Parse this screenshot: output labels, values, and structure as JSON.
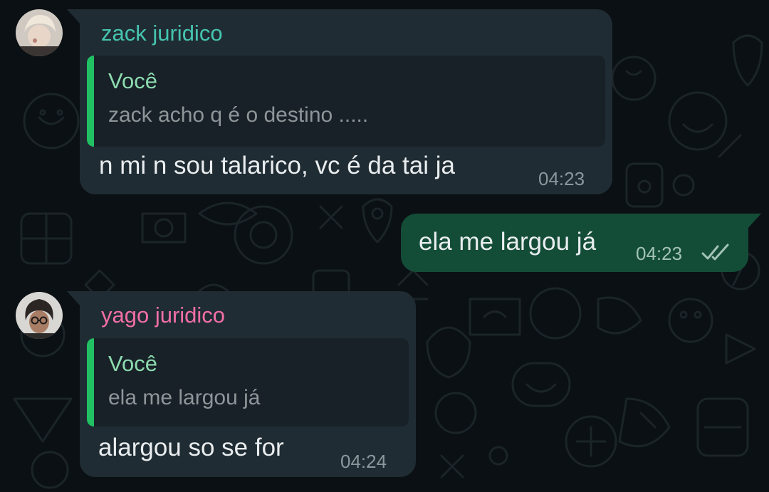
{
  "messages": [
    {
      "sender": "zack juridico",
      "sender_color": "#46c4b0",
      "quote": {
        "author": "Você",
        "text": "zack acho q é o destino ....."
      },
      "text": "n mi n sou talarico, vc é da tai ja",
      "time": "04:23"
    },
    {
      "outgoing": true,
      "text": "ela me largou já",
      "time": "04:23",
      "status": "delivered"
    },
    {
      "sender": "yago juridico",
      "sender_color": "#f26fa6",
      "quote": {
        "author": "Você",
        "text": "ela me largou já"
      },
      "text": "alargou so se for",
      "time": "04:24"
    }
  ],
  "icons": {
    "avatar_zack": "avatar",
    "avatar_yago": "avatar",
    "delivered": "double-check-icon"
  },
  "colors": {
    "background": "#0b1014",
    "incoming_bubble": "#202c33",
    "outgoing_bubble": "#144d37",
    "quote_bar": "#21c063",
    "quote_author": "#8ddbb0"
  }
}
